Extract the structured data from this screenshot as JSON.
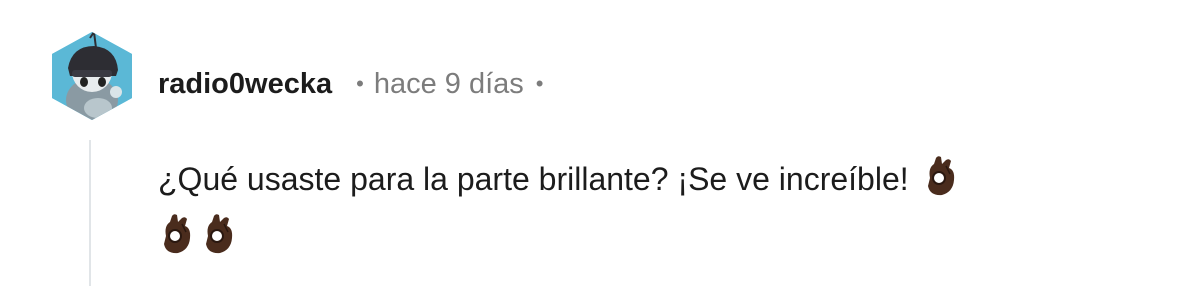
{
  "comment": {
    "author": "radio0wecka",
    "separator": "•",
    "timestamp": "hace 9 días",
    "trailing_separator": "•",
    "body_text": "¿Qué usaste para la parte brillante? ¡Se ve increíble!",
    "emojis": [
      "ok-hand-dark-skin",
      "ok-hand-dark-skin",
      "ok-hand-dark-skin"
    ]
  },
  "colors": {
    "author": "#1c1c1c",
    "meta": "#7c7c7c",
    "thread_line": "#e1e5e8",
    "emoji_skin": "#4a2c1d"
  }
}
